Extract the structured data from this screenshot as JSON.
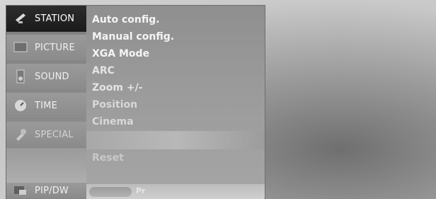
{
  "sidebar": {
    "items": [
      {
        "label": "STATION",
        "icon": "satellite-icon"
      },
      {
        "label": "PICTURE",
        "icon": "tv-icon"
      },
      {
        "label": "SOUND",
        "icon": "speaker-icon"
      },
      {
        "label": "TIME",
        "icon": "clock-icon"
      },
      {
        "label": "SPECIAL",
        "icon": "wrench-icon"
      },
      {
        "label": "PIP/DW",
        "icon": "pip-icon"
      }
    ]
  },
  "station_menu": {
    "items": [
      "Auto config.",
      "Manual config.",
      "XGA Mode",
      "ARC",
      "Zoom +/-",
      "Position",
      "Cinema"
    ],
    "reset_label": "Reset",
    "bottom_hint": "Pr"
  },
  "colors": {
    "active": "#1b1b1b",
    "panel": "#9a9a9a"
  }
}
